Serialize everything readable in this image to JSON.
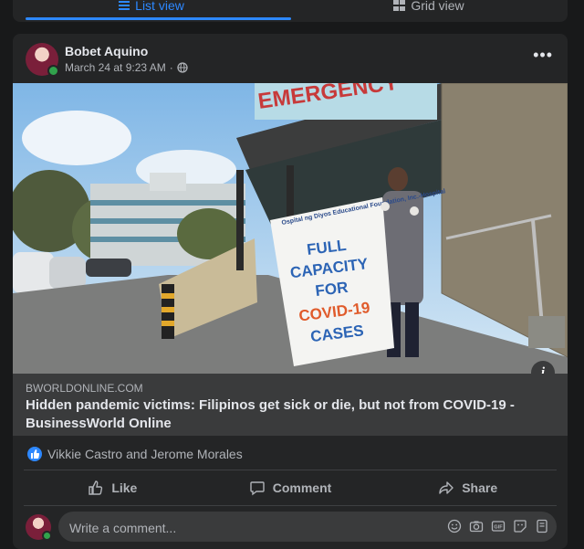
{
  "tabs": {
    "list_label": "List view",
    "grid_label": "Grid view"
  },
  "post": {
    "author": "Bobet Aquino",
    "timestamp": "March 24 at 9:23 AM",
    "separator": "·",
    "privacy_icon": "globe-icon",
    "link": {
      "domain": "BWORLDONLINE.COM",
      "headline": "Hidden pandemic victims: Filipinos get sick or die, but not from COVID-19 - BusinessWorld Online"
    },
    "photo": {
      "sign_top_text": "Ospital ng Diyos Educational Foundation, Inc.-Hospital",
      "sign_lines": [
        "FULL",
        "CAPACITY",
        "FOR",
        "COVID-19",
        "CASES"
      ],
      "building_sign": "EMERGENCY"
    },
    "reactions": {
      "text": "Vikkie Castro and Jerome Morales"
    },
    "actions": {
      "like": "Like",
      "comment": "Comment",
      "share": "Share"
    },
    "comment_input": {
      "placeholder": "Write a comment..."
    }
  },
  "colors": {
    "accent": "#2d88ff",
    "background": "#18191a",
    "card": "#242526",
    "online": "#31a24c"
  }
}
